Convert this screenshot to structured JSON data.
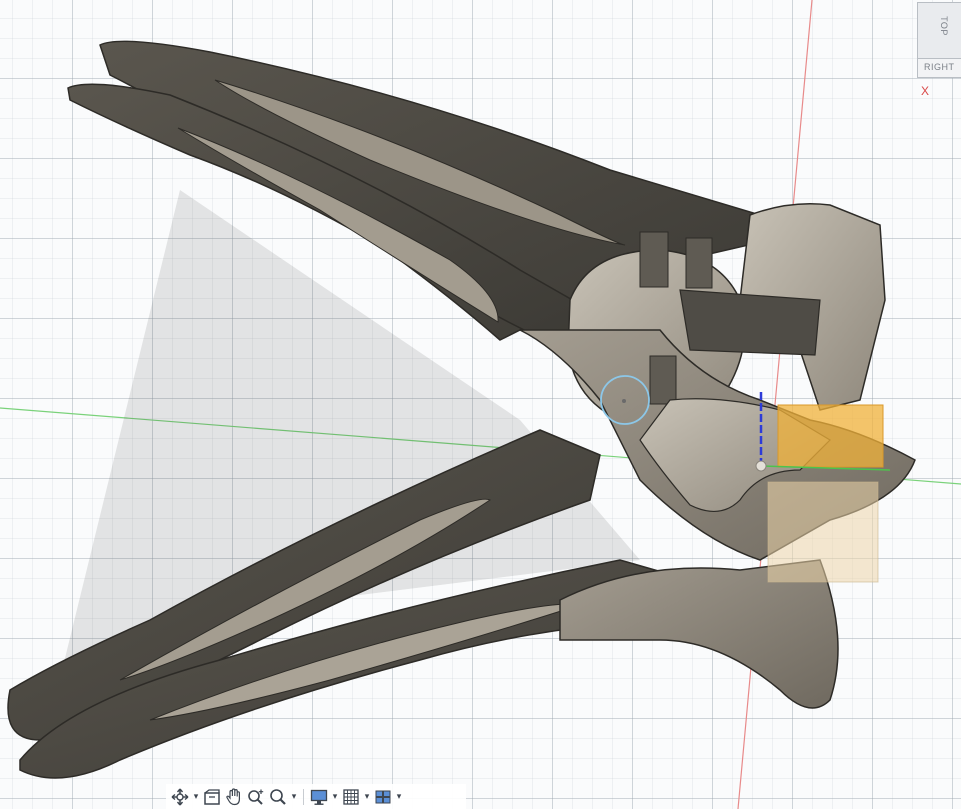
{
  "app": {
    "name": "3D modeling viewport"
  },
  "viewcube": {
    "top_label": "TOP",
    "right_label": "RIGHT",
    "axis_x_label": "X"
  },
  "colors": {
    "model_dark": "#4a4740",
    "model_face": "#8c857a",
    "selection": "#f0b23a",
    "axis_red": "#e05a5a",
    "axis_green": "#4cc44c",
    "axis_blue": "#2d3bd8"
  },
  "toolbar": {
    "items": [
      {
        "name": "orbit-icon",
        "has_dropdown": true
      },
      {
        "name": "look-at-icon",
        "has_dropdown": false
      },
      {
        "name": "pan-icon",
        "has_dropdown": false
      },
      {
        "name": "zoom-icon",
        "has_dropdown": false
      },
      {
        "name": "fit-zoom-icon",
        "has_dropdown": true
      },
      {
        "name": "display-settings-icon",
        "has_dropdown": true
      },
      {
        "name": "grid-settings-icon",
        "has_dropdown": true
      },
      {
        "name": "viewports-icon",
        "has_dropdown": true
      }
    ]
  }
}
